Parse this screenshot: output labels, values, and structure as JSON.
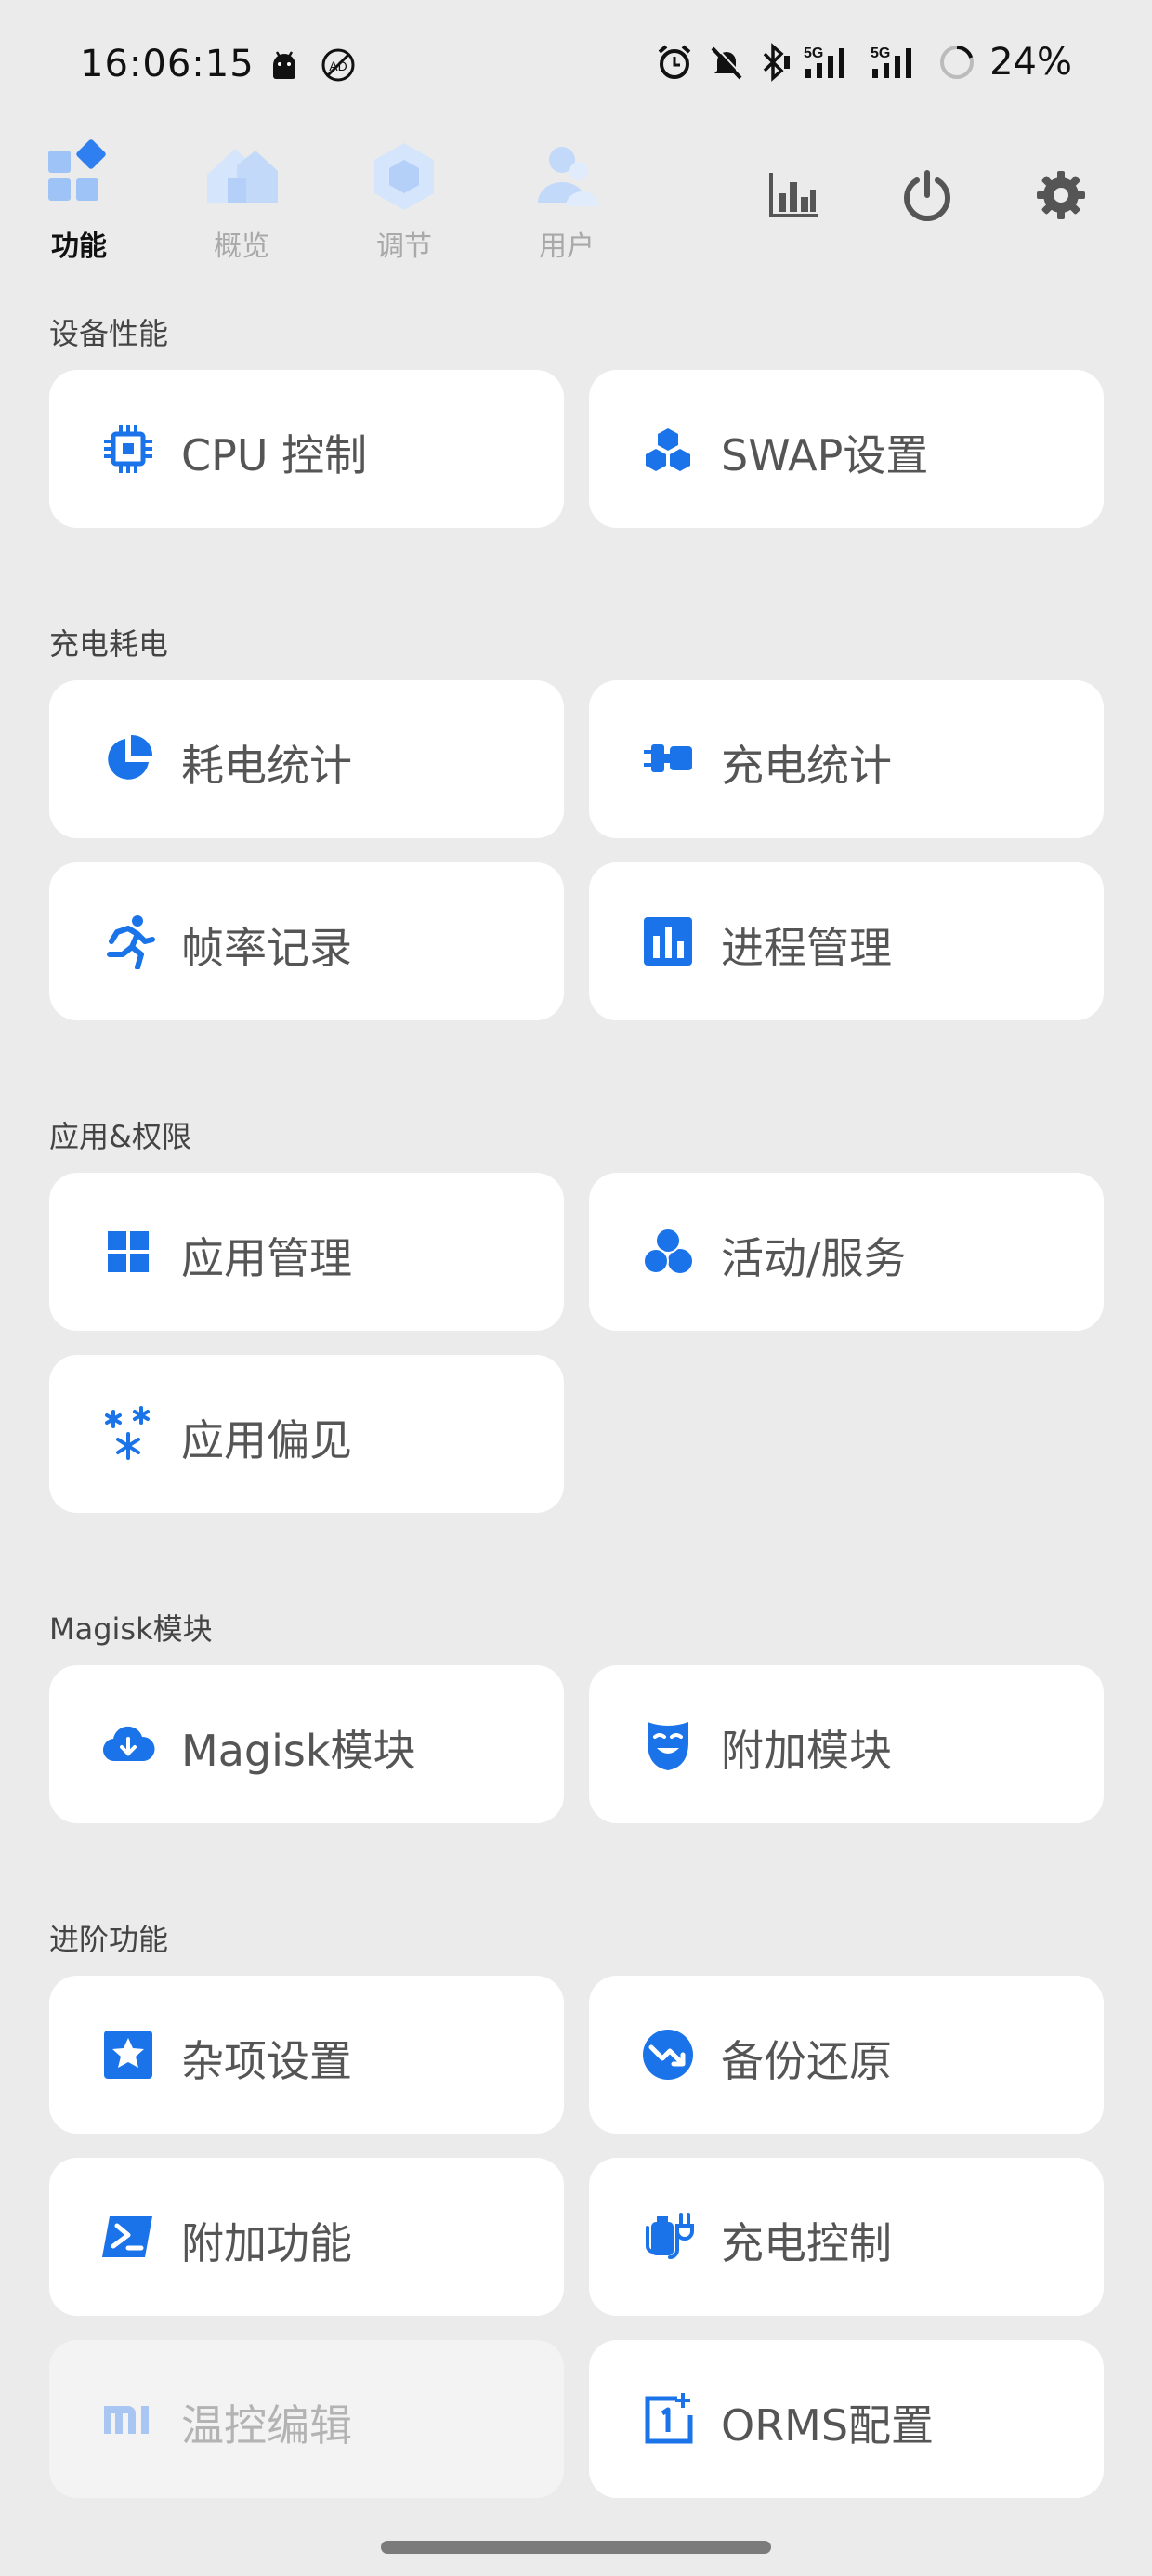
{
  "status_bar": {
    "time": "16:06:15",
    "network_1": "5G",
    "network_2": "5G",
    "battery": "24%"
  },
  "nav": {
    "tabs": [
      {
        "label": "功能",
        "active": true
      },
      {
        "label": "概览",
        "active": false
      },
      {
        "label": "调节",
        "active": false
      },
      {
        "label": "用户",
        "active": false
      }
    ],
    "actions": [
      "chart-icon",
      "power-icon",
      "gear-icon"
    ]
  },
  "colors": {
    "accent": "#1a73e8",
    "background": "#ebebeb",
    "card": "#ffffff"
  },
  "sections": [
    {
      "title": "设备性能",
      "items": [
        {
          "label": "CPU 控制",
          "icon": "cpu-icon"
        },
        {
          "label": "SWAP设置",
          "icon": "cubes-icon"
        }
      ]
    },
    {
      "title": "充电耗电",
      "items": [
        {
          "label": "耗电统计",
          "icon": "pie-icon"
        },
        {
          "label": "充电统计",
          "icon": "plug-battery-icon"
        },
        {
          "label": "帧率记录",
          "icon": "running-icon"
        },
        {
          "label": "进程管理",
          "icon": "bar-chart-icon"
        }
      ]
    },
    {
      "title": "应用&权限",
      "items": [
        {
          "label": "应用管理",
          "icon": "grid-icon"
        },
        {
          "label": "活动/服务",
          "icon": "circles-icon"
        },
        {
          "label": "应用偏见",
          "icon": "asterisks-icon"
        }
      ]
    },
    {
      "title": "Magisk模块",
      "items": [
        {
          "label": "Magisk模块",
          "icon": "cloud-download-icon"
        },
        {
          "label": "附加模块",
          "icon": "mask-icon"
        }
      ]
    },
    {
      "title": "进阶功能",
      "items": [
        {
          "label": "杂项设置",
          "icon": "star-icon"
        },
        {
          "label": "备份还原",
          "icon": "trend-down-icon"
        },
        {
          "label": "附加功能",
          "icon": "terminal-icon"
        },
        {
          "label": "充电控制",
          "icon": "battery-plug-icon"
        },
        {
          "label": "温控编辑",
          "icon": "mi-icon",
          "disabled": true
        },
        {
          "label": "ORMS配置",
          "icon": "oneplus-icon"
        }
      ]
    }
  ]
}
